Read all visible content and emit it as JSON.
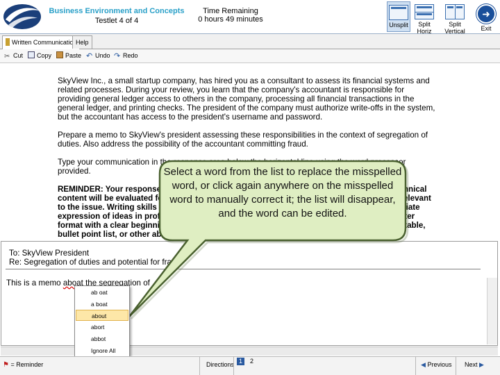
{
  "header": {
    "section_title": "Business Environment and Concepts",
    "testlet": "Testlet 4 of 4",
    "time_label": "Time Remaining",
    "time_value": "0 hours 49 minutes"
  },
  "view_buttons": {
    "unsplit": "Unsplit",
    "split_horiz": "Split Horiz",
    "split_vertical": "Split Vertical",
    "exit": "Exit"
  },
  "tabs": {
    "written": "Written Communication",
    "help": "Help"
  },
  "toolbar": {
    "cut": "Cut",
    "copy": "Copy",
    "paste": "Paste",
    "undo": "Undo",
    "redo": "Redo"
  },
  "passage": {
    "p1": "SkyView Inc., a small startup company, has hired you as a consultant to assess its financial systems and related processes. During your review, you learn that the company's accountant is responsible for providing general ledger access to others in the company, processing all financial transactions in the general ledger, and printing checks. The president of the company must authorize write-offs in the system, but the accountant has access to the president's username and password.",
    "p2": "Prepare a memo to SkyView's president assessing these responsibilities in the context of segregation of duties. Also address the possibility of the accountant committing fraud.",
    "p3": "Type your communication in the response area below the horizontal line using the word processor provided.",
    "p4": "REMINDER: Your response will be graded for both technical content and writing skills. Technical content will be evaluated for information that is helpful to the intended reader and clearly relevant to the issue. Writing skills will be evaluated for development, organization, and the appropriate expression of ideas in professional correspondence. Use a standard business memo or letter format with a clear beginning, middle, and end. Do not convey information in the form of a table, bullet point list, or other abbreviated presentation."
  },
  "memo": {
    "to": "To: SkyView President",
    "re": "Re: Segregation of duties and potential for fraud",
    "body_before": "This is a memo ",
    "misspelled": "aboat",
    "body_after": " the segregation of"
  },
  "context_menu": {
    "items": [
      "ab oat",
      "a boat",
      "about",
      "abort",
      "abbot",
      "Ignore All"
    ],
    "selected": "about"
  },
  "callout": {
    "text": "Select a word from the list to replace the misspelled word, or click again anywhere on the misspelled word to manually correct it; the list will disappear, and the word can be edited."
  },
  "footer": {
    "reminder": "= Reminder",
    "directions": "Directions",
    "pages": [
      "1",
      "2"
    ],
    "current_page": "1",
    "previous": "Previous",
    "next": "Next"
  },
  "colors": {
    "section_title": "#2aa0c8",
    "callout_fill": "#dfeec2",
    "callout_stroke": "#4a6130",
    "menu_selected": "#fde7a8",
    "misspell_underline": "#dd0000"
  }
}
